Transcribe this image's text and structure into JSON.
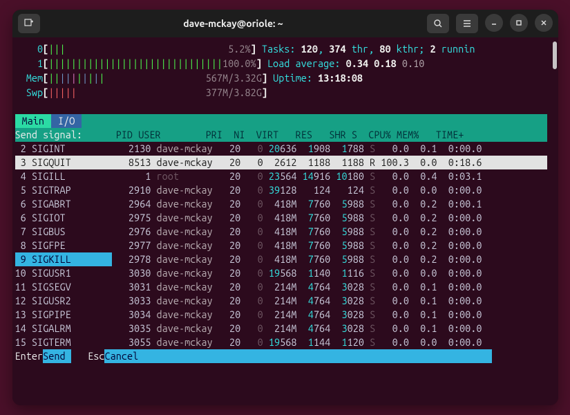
{
  "window": {
    "title": "dave-mckay@oriole: ~"
  },
  "meters": {
    "cpu0": {
      "label": "0",
      "bars": "|||",
      "pct": "5.2%"
    },
    "cpu1": {
      "label": "1",
      "bars": "|||||||||||||||||||||||||||||||",
      "pct": "100.0%"
    },
    "mem": {
      "label": "Mem",
      "bars": "||||||||||",
      "value": "567M/3.32G"
    },
    "swp": {
      "label": "Swp",
      "bars": "|||||",
      "value": "377M/3.82G"
    }
  },
  "summary": {
    "tasks_label": "Tasks: ",
    "tasks_procs": "120",
    "tasks_thr": "374",
    "tasks_thr_lbl": " thr, ",
    "tasks_kthr": "80",
    "tasks_kthr_lbl": " kthr; ",
    "tasks_running": "2",
    "tasks_running_lbl": " runnin",
    "load_label": "Load average: ",
    "load1": "0.34",
    "load5": "0.18",
    "load15": "0.10",
    "uptime_label": "Uptime: ",
    "uptime": "13:18:08"
  },
  "tabs": {
    "main": "Main",
    "io": "I/O"
  },
  "send_signal_label": "Send signal:",
  "columns": {
    "pid": "PID",
    "user": "USER",
    "pri": "PRI",
    "ni": "NI",
    "virt": "VIRT",
    "res": "RES",
    "shr": "SHR",
    "s": "S",
    "cpu": "CPU%",
    "mem": "MEM%",
    "time": "TIME+"
  },
  "signals": [
    {
      "num": "2",
      "name": "SIGINT"
    },
    {
      "num": "3",
      "name": "SIGQUIT"
    },
    {
      "num": "4",
      "name": "SIGILL"
    },
    {
      "num": "5",
      "name": "SIGTRAP"
    },
    {
      "num": "6",
      "name": "SIGABRT"
    },
    {
      "num": "6",
      "name": "SIGIOT"
    },
    {
      "num": "7",
      "name": "SIGBUS"
    },
    {
      "num": "8",
      "name": "SIGFPE"
    },
    {
      "num": "9",
      "name": "SIGKILL",
      "selected": true
    },
    {
      "num": "10",
      "name": "SIGUSR1"
    },
    {
      "num": "11",
      "name": "SIGSEGV"
    },
    {
      "num": "12",
      "name": "SIGUSR2"
    },
    {
      "num": "13",
      "name": "SIGPIPE"
    },
    {
      "num": "14",
      "name": "SIGALRM"
    },
    {
      "num": "15",
      "name": "SIGTERM"
    }
  ],
  "processes": [
    {
      "pid": "2130",
      "user": "dave-mckay",
      "pri": "20",
      "ni": "0",
      "virt_a": "20",
      "virt_b": "636",
      "res_a": "1",
      "res_b": "908",
      "shr_a": "1",
      "shr_b": "788",
      "s": "S",
      "cpu": "0.0",
      "mem": "0.1",
      "time": "0:00.0"
    },
    {
      "pid": "8513",
      "user": "dave-mckay",
      "pri": "20",
      "ni": "0",
      "virt_a": "",
      "virt_b": "2612",
      "res_a": "",
      "res_b": "1188",
      "shr_a": "",
      "shr_b": "1188",
      "s": "R",
      "cpu": "100.3",
      "mem": "0.0",
      "time": "0:18.6",
      "highlight": true
    },
    {
      "pid": "1",
      "user": "root",
      "pri": "20",
      "ni": "0",
      "virt_a": "23",
      "virt_b": "564",
      "res_a": "14",
      "res_b": "916",
      "shr_a": "10",
      "shr_b": "180",
      "s": "S",
      "cpu": "0.0",
      "mem": "0.4",
      "time": "0:03.1",
      "rootuser": true
    },
    {
      "pid": "2910",
      "user": "dave-mckay",
      "pri": "20",
      "ni": "0",
      "virt_a": "39",
      "virt_b": "128",
      "res_a": "",
      "res_b": "124",
      "shr_a": "",
      "shr_b": "124",
      "s": "S",
      "cpu": "0.0",
      "mem": "0.0",
      "time": "0:00.0"
    },
    {
      "pid": "2964",
      "user": "dave-mckay",
      "pri": "20",
      "ni": "0",
      "virt_a": "",
      "virt_b": "418M",
      "res_a": "7",
      "res_b": "760",
      "shr_a": "5",
      "shr_b": "988",
      "s": "S",
      "cpu": "0.0",
      "mem": "0.2",
      "time": "0:00.1"
    },
    {
      "pid": "2975",
      "user": "dave-mckay",
      "pri": "20",
      "ni": "0",
      "virt_a": "",
      "virt_b": "418M",
      "res_a": "7",
      "res_b": "760",
      "shr_a": "5",
      "shr_b": "988",
      "s": "S",
      "cpu": "0.0",
      "mem": "0.2",
      "time": "0:00.0"
    },
    {
      "pid": "2976",
      "user": "dave-mckay",
      "pri": "20",
      "ni": "0",
      "virt_a": "",
      "virt_b": "418M",
      "res_a": "7",
      "res_b": "760",
      "shr_a": "5",
      "shr_b": "988",
      "s": "S",
      "cpu": "0.0",
      "mem": "0.2",
      "time": "0:00.0"
    },
    {
      "pid": "2977",
      "user": "dave-mckay",
      "pri": "20",
      "ni": "0",
      "virt_a": "",
      "virt_b": "418M",
      "res_a": "7",
      "res_b": "760",
      "shr_a": "5",
      "shr_b": "988",
      "s": "S",
      "cpu": "0.0",
      "mem": "0.2",
      "time": "0:00.0"
    },
    {
      "pid": "2978",
      "user": "dave-mckay",
      "pri": "20",
      "ni": "0",
      "virt_a": "",
      "virt_b": "418M",
      "res_a": "7",
      "res_b": "760",
      "shr_a": "5",
      "shr_b": "988",
      "s": "S",
      "cpu": "0.0",
      "mem": "0.2",
      "time": "0:00.0"
    },
    {
      "pid": "3030",
      "user": "dave-mckay",
      "pri": "20",
      "ni": "0",
      "virt_a": "19",
      "virt_b": "568",
      "res_a": "1",
      "res_b": "140",
      "shr_a": "1",
      "shr_b": "116",
      "s": "S",
      "cpu": "0.0",
      "mem": "0.0",
      "time": "0:00.0"
    },
    {
      "pid": "3031",
      "user": "dave-mckay",
      "pri": "20",
      "ni": "0",
      "virt_a": "",
      "virt_b": "214M",
      "res_a": "4",
      "res_b": "764",
      "shr_a": "3",
      "shr_b": "028",
      "s": "S",
      "cpu": "0.0",
      "mem": "0.1",
      "time": "0:00.0"
    },
    {
      "pid": "3033",
      "user": "dave-mckay",
      "pri": "20",
      "ni": "0",
      "virt_a": "",
      "virt_b": "214M",
      "res_a": "4",
      "res_b": "764",
      "shr_a": "3",
      "shr_b": "028",
      "s": "S",
      "cpu": "0.0",
      "mem": "0.1",
      "time": "0:00.0"
    },
    {
      "pid": "3034",
      "user": "dave-mckay",
      "pri": "20",
      "ni": "0",
      "virt_a": "",
      "virt_b": "214M",
      "res_a": "4",
      "res_b": "764",
      "shr_a": "3",
      "shr_b": "028",
      "s": "S",
      "cpu": "0.0",
      "mem": "0.1",
      "time": "0:00.0"
    },
    {
      "pid": "3035",
      "user": "dave-mckay",
      "pri": "20",
      "ni": "0",
      "virt_a": "",
      "virt_b": "214M",
      "res_a": "4",
      "res_b": "764",
      "shr_a": "3",
      "shr_b": "028",
      "s": "S",
      "cpu": "0.0",
      "mem": "0.1",
      "time": "0:00.0"
    },
    {
      "pid": "3055",
      "user": "dave-mckay",
      "pri": "20",
      "ni": "0",
      "virt_a": "19",
      "virt_b": "568",
      "res_a": "1",
      "res_b": "144",
      "shr_a": "1",
      "shr_b": "120",
      "s": "S",
      "cpu": "0.0",
      "mem": "0.0",
      "time": "0:00.0"
    }
  ],
  "footer": {
    "enter_key": "Enter",
    "enter_label": "Send ",
    "esc_key": "Esc",
    "esc_label": "Cancel                                                               "
  }
}
